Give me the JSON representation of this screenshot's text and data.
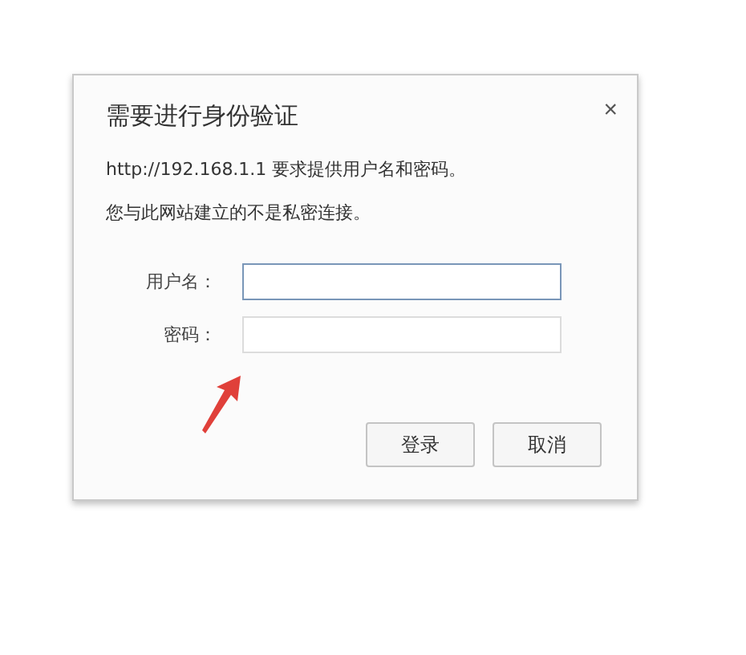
{
  "dialog": {
    "title": "需要进行身份验证",
    "close": "×",
    "message": "http://192.168.1.1 要求提供用户名和密码。",
    "notice": "您与此网站建立的不是私密连接。",
    "fields": [
      {
        "label": "用户名：",
        "focused": true
      },
      {
        "label": "密码：",
        "focused": false
      }
    ],
    "buttons": [
      {
        "label": "登录"
      },
      {
        "label": "取消"
      }
    ]
  }
}
